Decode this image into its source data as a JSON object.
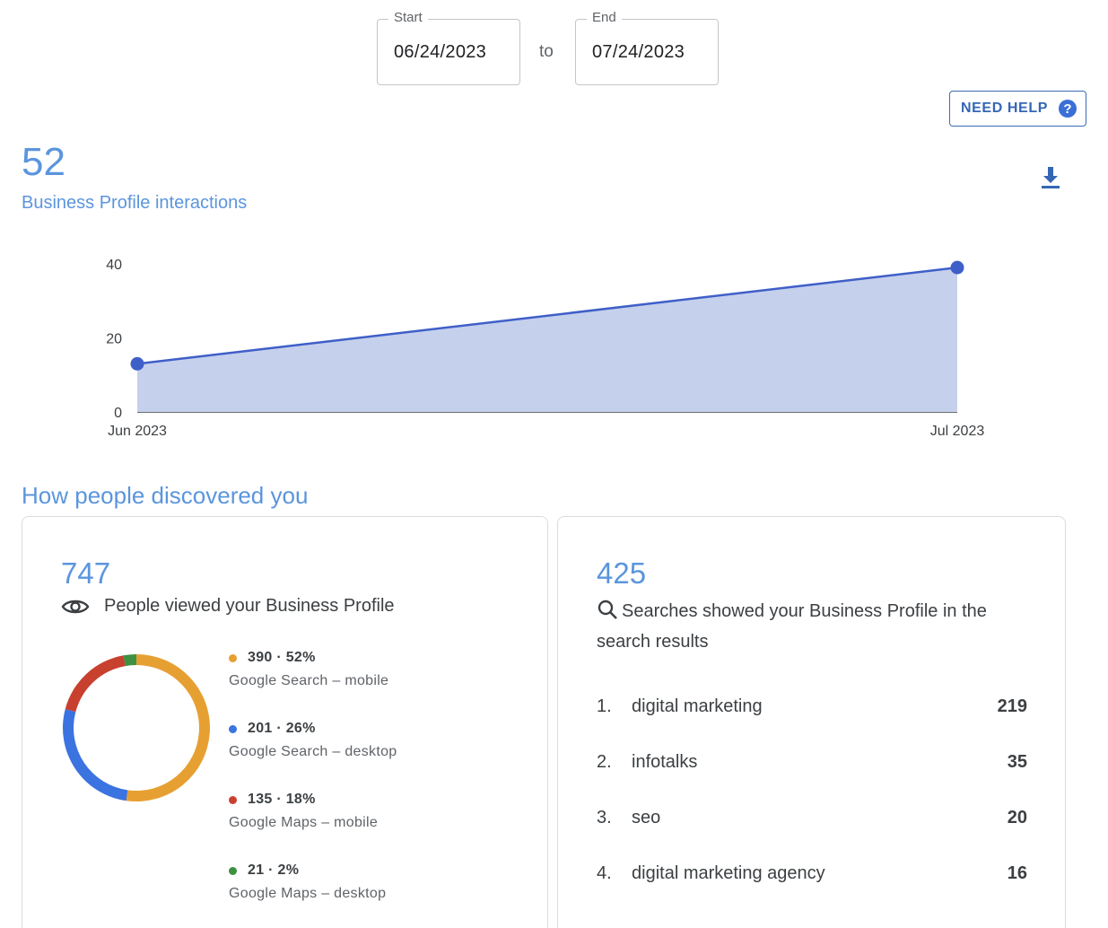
{
  "date_range": {
    "start_label": "Start",
    "start_value": "06/24/2023",
    "separator": "to",
    "end_label": "End",
    "end_value": "07/24/2023"
  },
  "help_button": {
    "label": "NEED HELP",
    "icon": "help-circle-icon"
  },
  "interactions": {
    "total": "52",
    "label": "Business Profile interactions",
    "download_icon": "download-icon"
  },
  "colors": {
    "accent": "#5b95dd",
    "line": "#3f5fc8",
    "area": "#c5d0ec",
    "mobile_search": "#e6a032",
    "desktop_search": "#3b73e0",
    "maps_mobile": "#c8402e",
    "maps_desktop": "#3d9140"
  },
  "chart_data": {
    "type": "area",
    "x": [
      "Jun 2023",
      "Jul 2023"
    ],
    "values": [
      13,
      39
    ],
    "yticks": [
      0,
      20,
      40
    ],
    "ylim": [
      0,
      40
    ],
    "grid": false,
    "title": "",
    "xlabel": "",
    "ylabel": ""
  },
  "discovery": {
    "title": "How people discovered you",
    "views": {
      "total": "747",
      "label": "People viewed your Business Profile",
      "icon": "eye-icon",
      "breakdown_chart": {
        "type": "pie",
        "categories": [
          "Google Search – mobile",
          "Google Search – desktop",
          "Google Maps – mobile",
          "Google Maps – desktop"
        ],
        "values": [
          390,
          201,
          135,
          21
        ]
      },
      "breakdown": [
        {
          "stat": "390 · 52%",
          "label": "Google Search – mobile",
          "color": "#e6a032"
        },
        {
          "stat": "201 · 26%",
          "label": "Google Search – desktop",
          "color": "#3b73e0"
        },
        {
          "stat": "135 · 18%",
          "label": "Google Maps – mobile",
          "color": "#c8402e"
        },
        {
          "stat": "21 · 2%",
          "label": "Google Maps – desktop",
          "color": "#3d9140"
        }
      ]
    },
    "searches": {
      "total": "425",
      "label": "Searches showed your Business Profile in the search results",
      "icon": "search-icon",
      "queries": [
        {
          "rank": "1.",
          "term": "digital marketing",
          "count": "219"
        },
        {
          "rank": "2.",
          "term": "infotalks",
          "count": "35"
        },
        {
          "rank": "3.",
          "term": "seo",
          "count": "20"
        },
        {
          "rank": "4.",
          "term": "digital marketing agency",
          "count": "16"
        }
      ]
    }
  }
}
